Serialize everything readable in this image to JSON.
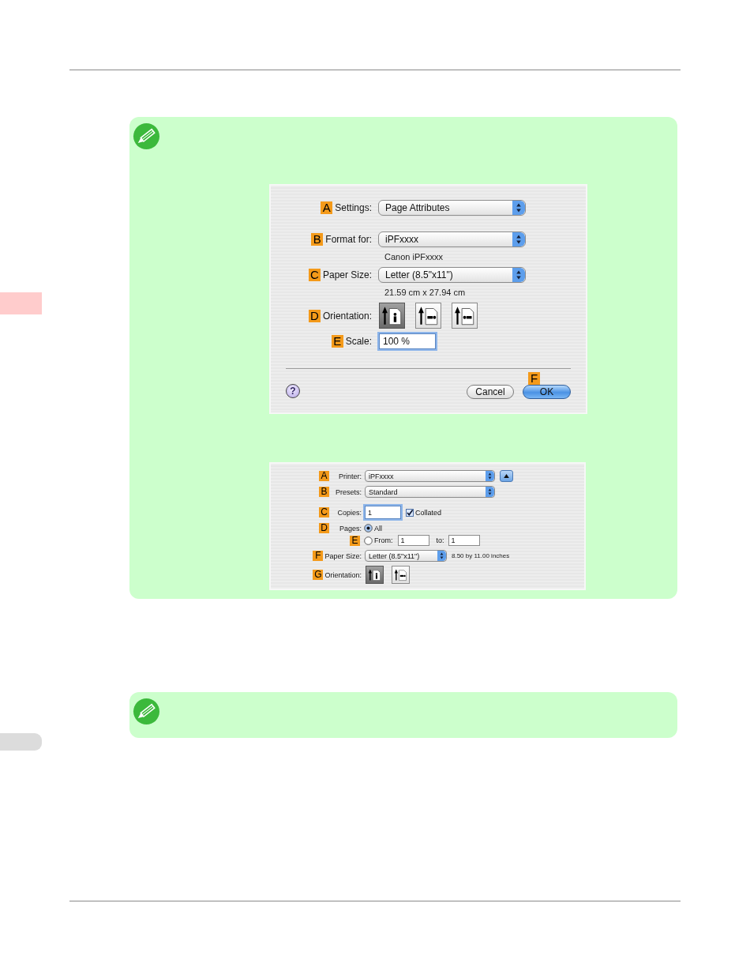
{
  "notes": [
    {
      "kind": "screenshots",
      "dialogs": [
        {
          "kind": "page_setup",
          "rows": [
            {
              "kind": "select",
              "callout": "A",
              "label": "Settings:",
              "value": "Page Attributes"
            },
            {
              "kind": "select",
              "callout": "B",
              "label": "Format for:",
              "value": "iPFxxxx",
              "note": "Canon iPFxxxx"
            },
            {
              "kind": "select",
              "callout": "C",
              "label": "Paper Size:",
              "value": "Letter (8.5\"x11\")",
              "note": "21.59 cm x 27.94 cm"
            },
            {
              "kind": "orientation",
              "callout": "D",
              "label": "Orientation:",
              "options": [
                {
                  "kind": "portrait",
                  "selected": true
                },
                {
                  "kind": "landscape",
                  "selected": false
                },
                {
                  "kind": "landscape_reversed",
                  "selected": false
                }
              ]
            },
            {
              "kind": "input",
              "callout": "E",
              "label": "Scale:",
              "value": "100 %",
              "focused": true
            }
          ],
          "help": "?",
          "buttons": [
            {
              "label": "Cancel",
              "default": false
            },
            {
              "label": "OK",
              "default": true,
              "callout": "F"
            }
          ]
        },
        {
          "kind": "print",
          "rows": [
            {
              "kind": "select",
              "callout": "A",
              "label": "Printer:",
              "value": "iPFxxxx",
              "disclosure": true
            },
            {
              "kind": "select",
              "callout": "B",
              "label": "Presets:",
              "value": "Standard"
            },
            {
              "kind": "copies",
              "callout": "C",
              "label": "Copies:",
              "value": "1",
              "focused": true,
              "checkbox": {
                "label": "Collated",
                "checked": true
              }
            },
            {
              "kind": "radio",
              "callout": "D",
              "label": "Pages:",
              "option": {
                "label": "All",
                "selected": true
              }
            },
            {
              "kind": "range",
              "callout": "E",
              "option": {
                "label": "From:",
                "selected": false
              },
              "from": "1",
              "to_label": "to:",
              "to": "1"
            },
            {
              "kind": "select",
              "callout": "F",
              "label": "Paper Size:",
              "value": "Letter (8.5\"x11\")",
              "note": "8.50 by 11.00 inches"
            },
            {
              "kind": "orientation",
              "callout": "G",
              "label": "Orientation:",
              "options": [
                {
                  "kind": "portrait",
                  "selected": true
                },
                {
                  "kind": "landscape",
                  "selected": false
                }
              ]
            }
          ]
        }
      ]
    },
    {
      "kind": "blank"
    }
  ]
}
